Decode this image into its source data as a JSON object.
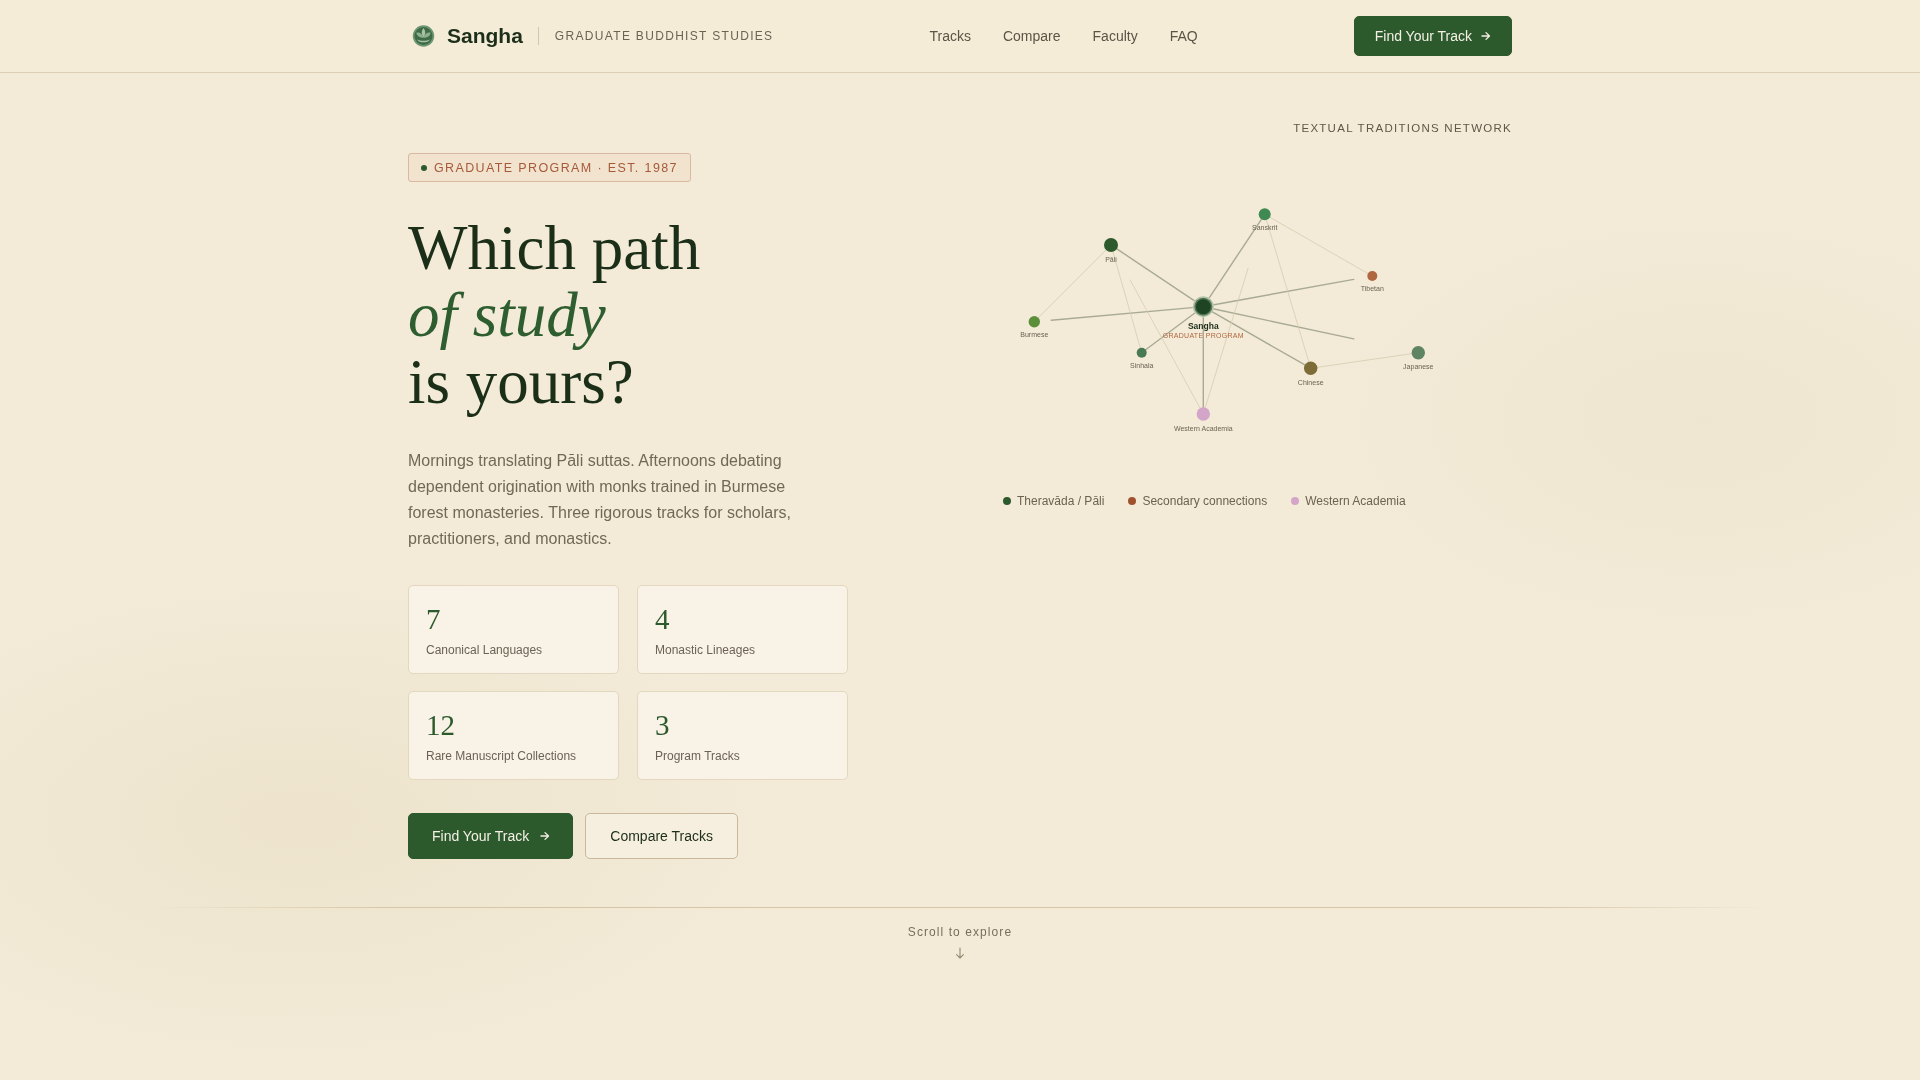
{
  "header": {
    "brand": "Sangha",
    "tagline": "GRADUATE BUDDHIST STUDIES",
    "nav": [
      "Tracks",
      "Compare",
      "Faculty",
      "FAQ"
    ],
    "cta": "Find Your Track"
  },
  "hero": {
    "badge": "GRADUATE PROGRAM · EST. 1987",
    "heading_lines": [
      "Which path",
      "*of study*",
      "is yours?"
    ],
    "intro": "Mornings translating Pāli suttas. Afternoons debating dependent origination with monks trained in Burmese forest monasteries. Three rigorous tracks for scholars, practitioners, and monastics.",
    "stats": [
      {
        "value": "7",
        "label": "Canonical Languages"
      },
      {
        "value": "4",
        "label": "Monastic Lineages"
      },
      {
        "value": "12",
        "label": "Rare Manuscript Collections"
      },
      {
        "value": "3",
        "label": "Program Tracks"
      }
    ],
    "buttons": [
      {
        "label": "Find Your Track",
        "kind": "primary"
      },
      {
        "label": "Compare Tracks",
        "kind": "secondary"
      }
    ]
  },
  "network": {
    "title": "TEXTUAL TRADITIONS NETWORK",
    "nodes": [
      {
        "label": "Sangha",
        "sublabel": "GRADUATE PROGRAM",
        "kind": "hub",
        "color": "#1e4424"
      },
      {
        "label": "Pāli",
        "kind": "node",
        "color": "#2d5a2d"
      },
      {
        "label": "Sanskrit",
        "kind": "node",
        "color": "#3f8a52"
      },
      {
        "label": "Tibetan",
        "kind": "node",
        "color": "#b0663f"
      },
      {
        "label": "Burmese",
        "kind": "node",
        "color": "#5b8f3a"
      },
      {
        "label": "Sinhala",
        "kind": "node",
        "color": "#4a7a52"
      },
      {
        "label": "Chinese",
        "kind": "node",
        "color": "#7d6c38"
      },
      {
        "label": "Japanese",
        "kind": "node",
        "color": "#5e8464"
      },
      {
        "label": "Western Academia",
        "kind": "node",
        "color": "#d2a5c9"
      }
    ],
    "legend": [
      {
        "label": "Theravāda / Pāli",
        "color": "#2d5a2d"
      },
      {
        "label": "Secondary connections",
        "color": "#a0522d"
      },
      {
        "label": "Western Academia",
        "color": "#d4a5c8"
      }
    ]
  },
  "scroll_hint": "Scroll to explore"
}
